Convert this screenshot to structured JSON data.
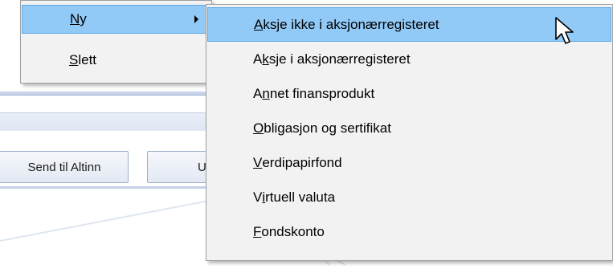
{
  "background": {
    "buttons": {
      "send_label": "Send til Altinn",
      "partial_label": "U"
    }
  },
  "main_menu": {
    "items": [
      {
        "accel": "N",
        "rest": "y",
        "has_submenu": true,
        "highlighted": true
      },
      {
        "accel": "S",
        "rest": "lett",
        "has_submenu": false,
        "highlighted": false
      }
    ]
  },
  "submenu": {
    "items": [
      {
        "pre": "",
        "accel": "A",
        "post": "ksje ikke i aksjonærregisteret",
        "highlighted": true
      },
      {
        "pre": "A",
        "accel": "k",
        "post": "sje i aksjonærregisteret",
        "highlighted": false
      },
      {
        "pre": "A",
        "accel": "n",
        "post": "net finansprodukt",
        "highlighted": false
      },
      {
        "pre": "",
        "accel": "O",
        "post": "bligasjon og sertifikat",
        "highlighted": false
      },
      {
        "pre": "",
        "accel": "V",
        "post": "erdipapirfond",
        "highlighted": false
      },
      {
        "pre": "V",
        "accel": "i",
        "post": "rtuell valuta",
        "highlighted": false
      },
      {
        "pre": "",
        "accel": "F",
        "post": "ondskonto",
        "highlighted": false
      }
    ]
  },
  "colors": {
    "menu_background": "#f2f2f2",
    "highlight": "#91c9f7",
    "highlight_border": "#62a8e8"
  }
}
